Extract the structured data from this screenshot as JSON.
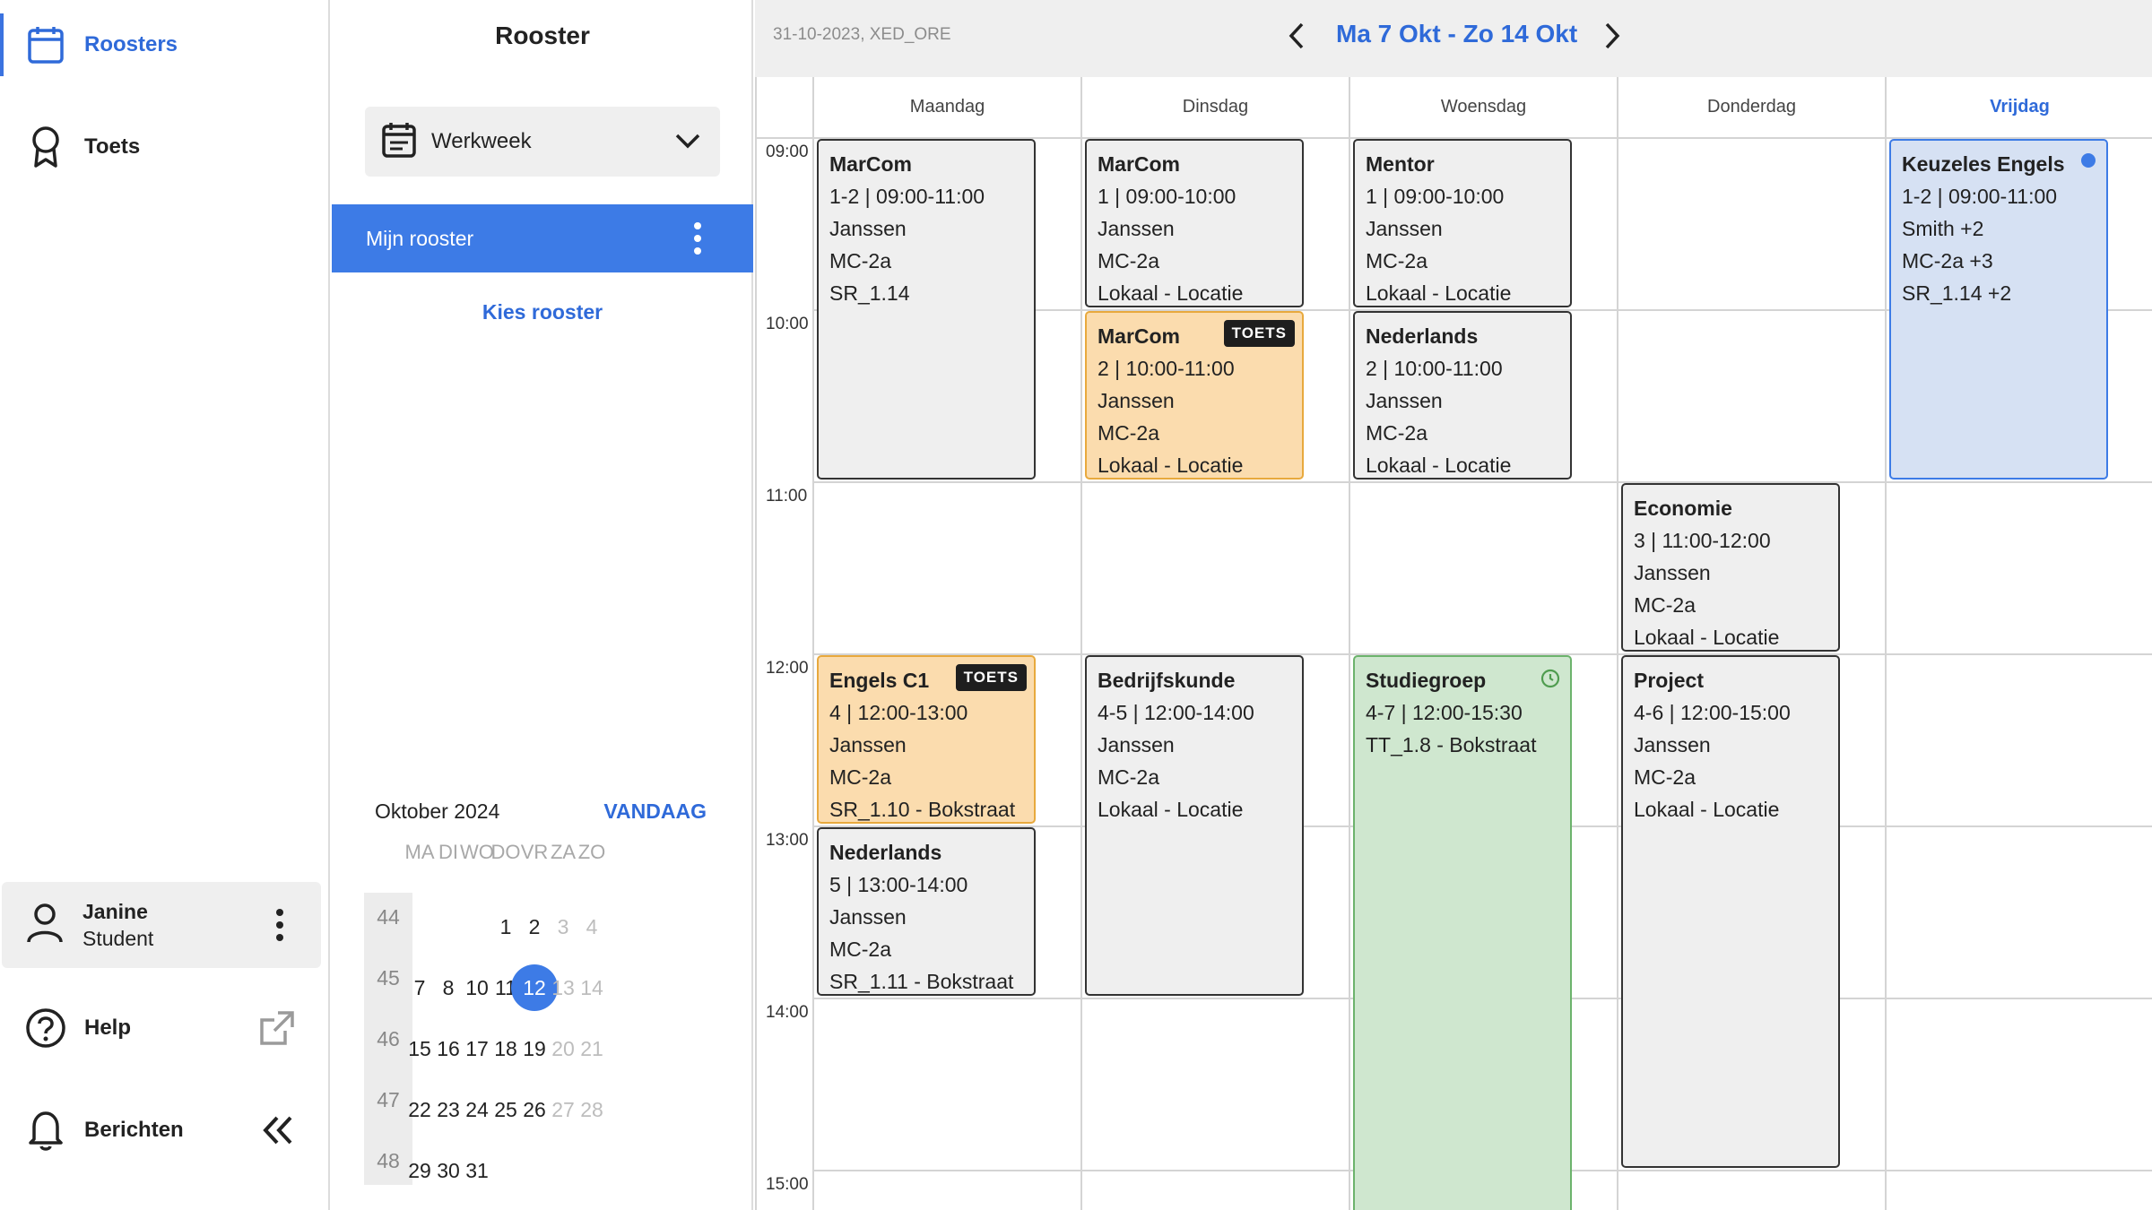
{
  "nav": {
    "roosters": "Roosters",
    "toets": "Toets",
    "user_name": "Janine",
    "user_role": "Student",
    "help": "Help",
    "berichten": "Berichten"
  },
  "panel": {
    "title": "Rooster",
    "view_select": "Werkweek",
    "my_roster": "Mijn rooster",
    "choose_roster": "Kies rooster"
  },
  "mini_calendar": {
    "month": "Oktober 2024",
    "today_label": "VANDAAG",
    "dow": [
      "MA",
      "DI",
      "WO",
      "DO",
      "VR",
      "ZA",
      "ZO"
    ],
    "weeks": [
      {
        "wk": "44",
        "days": [
          "",
          "",
          "",
          "1",
          "2",
          "3",
          "4"
        ]
      },
      {
        "wk": "45",
        "days": [
          "7",
          "8",
          "10",
          "11",
          "12",
          "13",
          "14"
        ]
      },
      {
        "wk": "46",
        "days": [
          "15",
          "16",
          "17",
          "18",
          "19",
          "20",
          "21"
        ]
      },
      {
        "wk": "47",
        "days": [
          "22",
          "23",
          "24",
          "25",
          "26",
          "27",
          "28"
        ]
      },
      {
        "wk": "48",
        "days": [
          "29",
          "30",
          "31",
          "",
          "",
          "",
          ""
        ]
      }
    ],
    "selected": "12"
  },
  "schedule": {
    "meta": "31-10-2023, XED_ORE",
    "range": "Ma 7 Okt - Zo 14 Okt",
    "days": [
      "Maandag",
      "Dinsdag",
      "Woensdag",
      "Donderdag",
      "Vrijdag"
    ],
    "times": [
      "09:00",
      "10:00",
      "11:00",
      "12:00",
      "13:00",
      "14:00",
      "15:00"
    ],
    "events": [
      {
        "col": 0,
        "start": 9,
        "end": 11,
        "style": "plain",
        "title": "MarCom",
        "lines": [
          "1-2 | 09:00-11:00",
          "Janssen",
          "MC-2a",
          "SR_1.14"
        ]
      },
      {
        "col": 0,
        "start": 12,
        "end": 13,
        "style": "exam",
        "badge": "TOETS",
        "title": "Engels C1",
        "lines": [
          "4 | 12:00-13:00",
          "Janssen",
          "MC-2a",
          "SR_1.10 - Bokstraat"
        ]
      },
      {
        "col": 0,
        "start": 13,
        "end": 14,
        "style": "plain",
        "title": "Nederlands",
        "lines": [
          "5 | 13:00-14:00",
          "Janssen",
          "MC-2a",
          "SR_1.11 - Bokstraat"
        ]
      },
      {
        "col": 1,
        "start": 9,
        "end": 10,
        "style": "plain",
        "title": "MarCom",
        "lines": [
          "1 | 09:00-10:00",
          "Janssen",
          "MC-2a",
          "Lokaal - Locatie"
        ]
      },
      {
        "col": 1,
        "start": 10,
        "end": 11,
        "style": "exam",
        "badge": "TOETS",
        "title": "MarCom",
        "lines": [
          "2 | 10:00-11:00",
          "Janssen",
          "MC-2a",
          "Lokaal - Locatie"
        ]
      },
      {
        "col": 1,
        "start": 12,
        "end": 14,
        "style": "plain",
        "title": "Bedrijfskunde",
        "lines": [
          "4-5 | 12:00-14:00",
          "Janssen",
          "MC-2a",
          "Lokaal - Locatie"
        ]
      },
      {
        "col": 2,
        "start": 9,
        "end": 10,
        "style": "plain",
        "title": "Mentor",
        "lines": [
          "1 | 09:00-10:00",
          "Janssen",
          "MC-2a",
          "Lokaal - Locatie"
        ]
      },
      {
        "col": 2,
        "start": 10,
        "end": 11,
        "style": "plain",
        "title": "Nederlands",
        "lines": [
          "2 | 10:00-11:00",
          "Janssen",
          "MC-2a",
          "Lokaal - Locatie"
        ]
      },
      {
        "col": 2,
        "start": 12,
        "end": 15.5,
        "style": "green",
        "icon": "clock-icon",
        "title": "Studiegroep",
        "lines": [
          "4-7 | 12:00-15:30",
          "TT_1.8 - Bokstraat"
        ]
      },
      {
        "col": 3,
        "start": 11,
        "end": 12,
        "style": "plain",
        "title": "Economie",
        "lines": [
          "3 | 11:00-12:00",
          "Janssen",
          "MC-2a",
          "Lokaal - Locatie"
        ]
      },
      {
        "col": 3,
        "start": 12,
        "end": 15,
        "style": "plain",
        "title": "Project",
        "lines": [
          "4-6 | 12:00-15:00",
          "Janssen",
          "MC-2a",
          "Lokaal - Locatie"
        ]
      },
      {
        "col": 4,
        "start": 9,
        "end": 11,
        "style": "blue",
        "dot": true,
        "title": "Keuzeles Engels",
        "lines": [
          "1-2 | 09:00-11:00",
          "Smith +2",
          "MC-2a +3",
          "SR_1.14 +2"
        ]
      }
    ]
  },
  "colors": {
    "accent": "#3d7be6",
    "exam_bg": "#fbdcae",
    "exam_border": "#e8a93d",
    "study_bg": "#cfe7cf",
    "elective_bg": "#d6e1f3"
  }
}
